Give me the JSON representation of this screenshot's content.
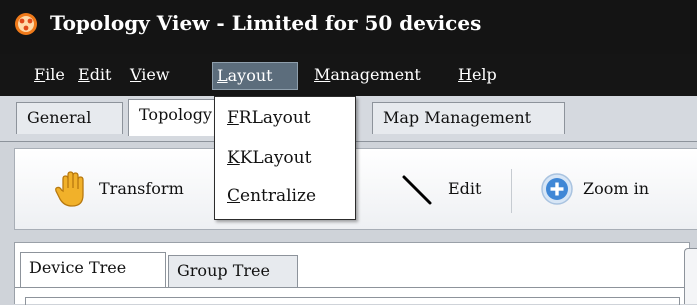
{
  "window": {
    "title": "Topology View - Limited for 50 devices",
    "icon": "app-logo-icon"
  },
  "menubar": {
    "items": [
      {
        "mnemonic": "F",
        "rest": "ile"
      },
      {
        "mnemonic": "E",
        "rest": "dit"
      },
      {
        "mnemonic": "V",
        "rest": "iew"
      },
      {
        "mnemonic": "L",
        "rest": "ayout",
        "active": true
      },
      {
        "mnemonic": "M",
        "rest": "anagement"
      },
      {
        "mnemonic": "H",
        "rest": "elp"
      }
    ]
  },
  "tabs": {
    "items": [
      {
        "label": "General"
      },
      {
        "label": "Topology View",
        "selected": true
      },
      {
        "label": "Map Management"
      }
    ]
  },
  "toolbar": {
    "transform_label": "Transform",
    "edit_label": "Edit",
    "zoom_in_label": "Zoom in",
    "icons": {
      "transform": "hand-icon",
      "edit": "line-icon",
      "zoom_in": "plus-circle-icon"
    }
  },
  "layout_menu": {
    "items": [
      {
        "mnemonic": "F",
        "rest": "RLayout"
      },
      {
        "mnemonic": "K",
        "rest": "KLayout"
      },
      {
        "mnemonic": "C",
        "rest": "entralize"
      }
    ]
  },
  "left_panel": {
    "tabs": [
      {
        "label": "Device Tree",
        "selected": true
      },
      {
        "label": "Group Tree"
      }
    ]
  },
  "colors": {
    "titlebar": "#141414",
    "menu_active": "#5c6d7c",
    "zoom_icon": "#3f87d6",
    "hand_icon": "#f1b12a"
  }
}
